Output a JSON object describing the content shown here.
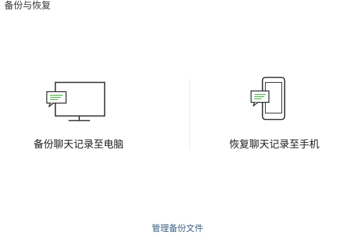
{
  "window": {
    "title": "备份与恢复"
  },
  "options": {
    "backup": {
      "label": "备份聊天记录至电脑",
      "icon": "monitor-chat-icon"
    },
    "restore": {
      "label": "恢复聊天记录至手机",
      "icon": "phone-chat-icon"
    }
  },
  "footer": {
    "manage_label": "管理备份文件"
  },
  "colors": {
    "icon_stroke": "#2b2b2b",
    "chat_bubble": "#4fb24c",
    "link": "#3c5f85",
    "divider": "#ececec"
  }
}
